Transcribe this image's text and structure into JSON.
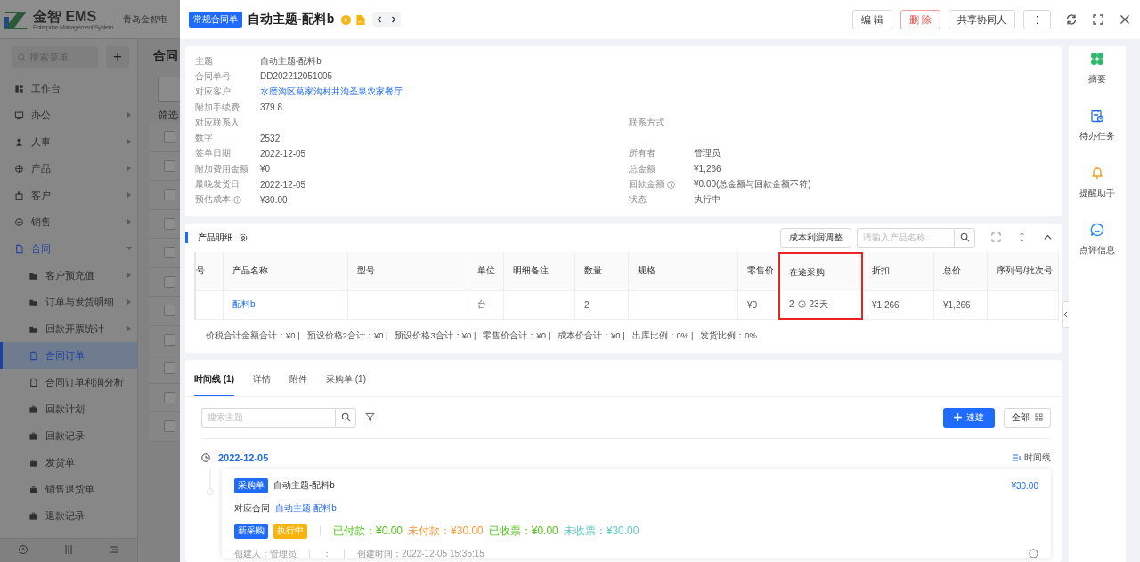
{
  "app": {
    "logo_text": "金智 EMS",
    "logo_subtitle": "Enterprise Management System",
    "company": "青岛金智电"
  },
  "sidebar": {
    "search_placeholder": "搜索菜单",
    "add_button": "+",
    "items": [
      {
        "label": "工作台",
        "kind": "link",
        "selected": false
      },
      {
        "label": "办公",
        "kind": "group",
        "expanded": false,
        "selected": false
      },
      {
        "label": "人事",
        "kind": "group",
        "expanded": false,
        "selected": false
      },
      {
        "label": "产品",
        "kind": "group",
        "expanded": false,
        "selected": false
      },
      {
        "label": "客户",
        "kind": "group",
        "expanded": false,
        "selected": false
      },
      {
        "label": "销售",
        "kind": "group",
        "expanded": false,
        "selected": false
      },
      {
        "label": "合同",
        "kind": "group",
        "expanded": true,
        "selected": false,
        "children": [
          {
            "label": "客户预充值",
            "kind": "group",
            "expanded": false,
            "selected": false
          },
          {
            "label": "订单与发货明细",
            "kind": "group",
            "expanded": false,
            "selected": false
          },
          {
            "label": "回款开票统计",
            "kind": "group",
            "expanded": false,
            "selected": false
          },
          {
            "label": "合同订单",
            "kind": "link",
            "selected": true
          },
          {
            "label": "合同订单利润分析",
            "kind": "link",
            "selected": false
          },
          {
            "label": "回款计划",
            "kind": "link",
            "selected": false
          },
          {
            "label": "回款记录",
            "kind": "link",
            "selected": false
          },
          {
            "label": "发货单",
            "kind": "link",
            "selected": false
          },
          {
            "label": "销售退货单",
            "kind": "link",
            "selected": false
          },
          {
            "label": "退款记录",
            "kind": "link",
            "selected": false
          }
        ]
      }
    ]
  },
  "background_list": {
    "title": "合同",
    "filter_label": "筛选",
    "rows": [
      {
        "checked": false
      },
      {
        "checked": false
      },
      {
        "checked": false
      },
      {
        "checked": false
      },
      {
        "checked": false
      },
      {
        "checked": false
      },
      {
        "checked": false
      },
      {
        "checked": false
      },
      {
        "checked": false
      },
      {
        "checked": false
      },
      {
        "checked": false
      }
    ]
  },
  "drawer": {
    "type_tag": "常规合同单",
    "title": "自动主题-配料b",
    "actions": [
      {
        "label": "编 辑",
        "kind": "default"
      },
      {
        "label": "删 除",
        "kind": "danger"
      },
      {
        "label": "共享协同人",
        "kind": "default"
      },
      {
        "label": "⋮",
        "kind": "default"
      }
    ]
  },
  "details": [
    {
      "left": {
        "label": "主题",
        "value": "自动主题-配料b"
      }
    },
    {
      "left": {
        "label": "合同单号",
        "value": "DD202212051005"
      }
    },
    {
      "left": {
        "label": "对应客户",
        "value": "水磨沟区葛家沟村井沟圣泉农家餐厅",
        "link": true
      }
    },
    {
      "left": {
        "label": "附加手续费",
        "value": "379.8"
      }
    },
    {
      "left": {
        "label": "对应联系人"
      },
      "right": {
        "label": "联系方式"
      }
    },
    {
      "left": {
        "label": "数字",
        "value": "2532"
      }
    },
    {
      "left": {
        "label": "签单日期",
        "value": "2022-12-05"
      },
      "right": {
        "label": "所有者",
        "value": "管理员"
      }
    },
    {
      "left": {
        "label": "附加费用金额",
        "value": "¥0"
      },
      "right": {
        "label": "总金额",
        "value": "¥1,266"
      }
    },
    {
      "left": {
        "label": "最晚发货日",
        "value": "2022-12-05"
      },
      "right": {
        "label": "回款金额",
        "value": "¥0.00(总金额与回款金额不符)",
        "info": true
      }
    },
    {
      "left": {
        "label": "预估成本",
        "value": "¥30.00",
        "info": true
      },
      "right": {
        "label": "状态",
        "value": "执行中"
      }
    }
  ],
  "products": {
    "title": "产品明细",
    "adjust_button": "成本利润调整",
    "search_placeholder": "请输入产品名称...",
    "columns": [
      {
        "label": "号",
        "highlighted": false
      },
      {
        "label": "产品名称",
        "highlighted": false
      },
      {
        "label": "型号",
        "highlighted": false
      },
      {
        "label": "单位",
        "highlighted": false
      },
      {
        "label": "明细备注",
        "highlighted": false
      },
      {
        "label": "数量",
        "highlighted": false
      },
      {
        "label": "规格",
        "highlighted": false
      },
      {
        "label": "零售价",
        "highlighted": false
      },
      {
        "label": "在途采购",
        "highlighted": true
      },
      {
        "label": "折扣",
        "highlighted": false
      },
      {
        "label": "总价",
        "highlighted": false
      },
      {
        "label": "序列号/批次号",
        "highlighted": false
      }
    ],
    "rows": [
      {
        "cells": [
          {
            "kind": "empty"
          },
          {
            "kind": "link",
            "text": "配料b"
          },
          {
            "kind": "empty"
          },
          {
            "kind": "text",
            "text": "台"
          },
          {
            "kind": "empty"
          },
          {
            "kind": "text",
            "text": "2"
          },
          {
            "kind": "empty"
          },
          {
            "kind": "text",
            "text": "¥0"
          },
          {
            "kind": "transit",
            "text": "2",
            "days": "23天"
          },
          {
            "kind": "text",
            "text": "¥1,266"
          },
          {
            "kind": "text",
            "text": "¥1,266"
          },
          {
            "kind": "empty"
          }
        ]
      }
    ],
    "summary": "价税合计金额合计：¥0 |   预设价格2合计：¥0 |   预设价格3合计：¥0 |   零售价合计：¥0 |   成本价合计：¥0 |   出库比例：0% |   发货比例：0%"
  },
  "timeline": {
    "tabs": [
      {
        "label": "时间线 (1)",
        "selected": true
      },
      {
        "label": "详情",
        "selected": false
      },
      {
        "label": "附件",
        "selected": false
      },
      {
        "label": "采购单 (1)",
        "selected": false
      }
    ],
    "search_placeholder": "搜索主题",
    "quick_button": "速建",
    "all_button": "全部",
    "date": "2022-12-05",
    "view_label": "时间线",
    "entry": {
      "tag": "采购单",
      "title": "自动主题-配料b",
      "amount": "¥30.00",
      "contract_label": "对应合同",
      "contract_link": "自动主题-配料b",
      "badges": [
        {
          "label": "新采购",
          "color": "#1f6bff"
        },
        {
          "label": "执行中",
          "color": "#fbb30e"
        }
      ],
      "stats": [
        {
          "text": "已付款：¥0.00",
          "color": "#52c41a"
        },
        {
          "text": "未付款：¥30.00",
          "color": "#fa9a3c"
        },
        {
          "text": "已收票：¥0.00",
          "color": "#52c41a"
        },
        {
          "text": "未收票：¥30.00",
          "color": "#5cc9c4"
        }
      ],
      "meta": [
        "创建人：管理员",
        "：",
        "创建时间：2022-12-05 15:35:15"
      ]
    }
  },
  "rail": [
    {
      "label": "摘要"
    },
    {
      "label": "待办任务"
    },
    {
      "label": "提醒助手"
    },
    {
      "label": "点评信息"
    }
  ]
}
